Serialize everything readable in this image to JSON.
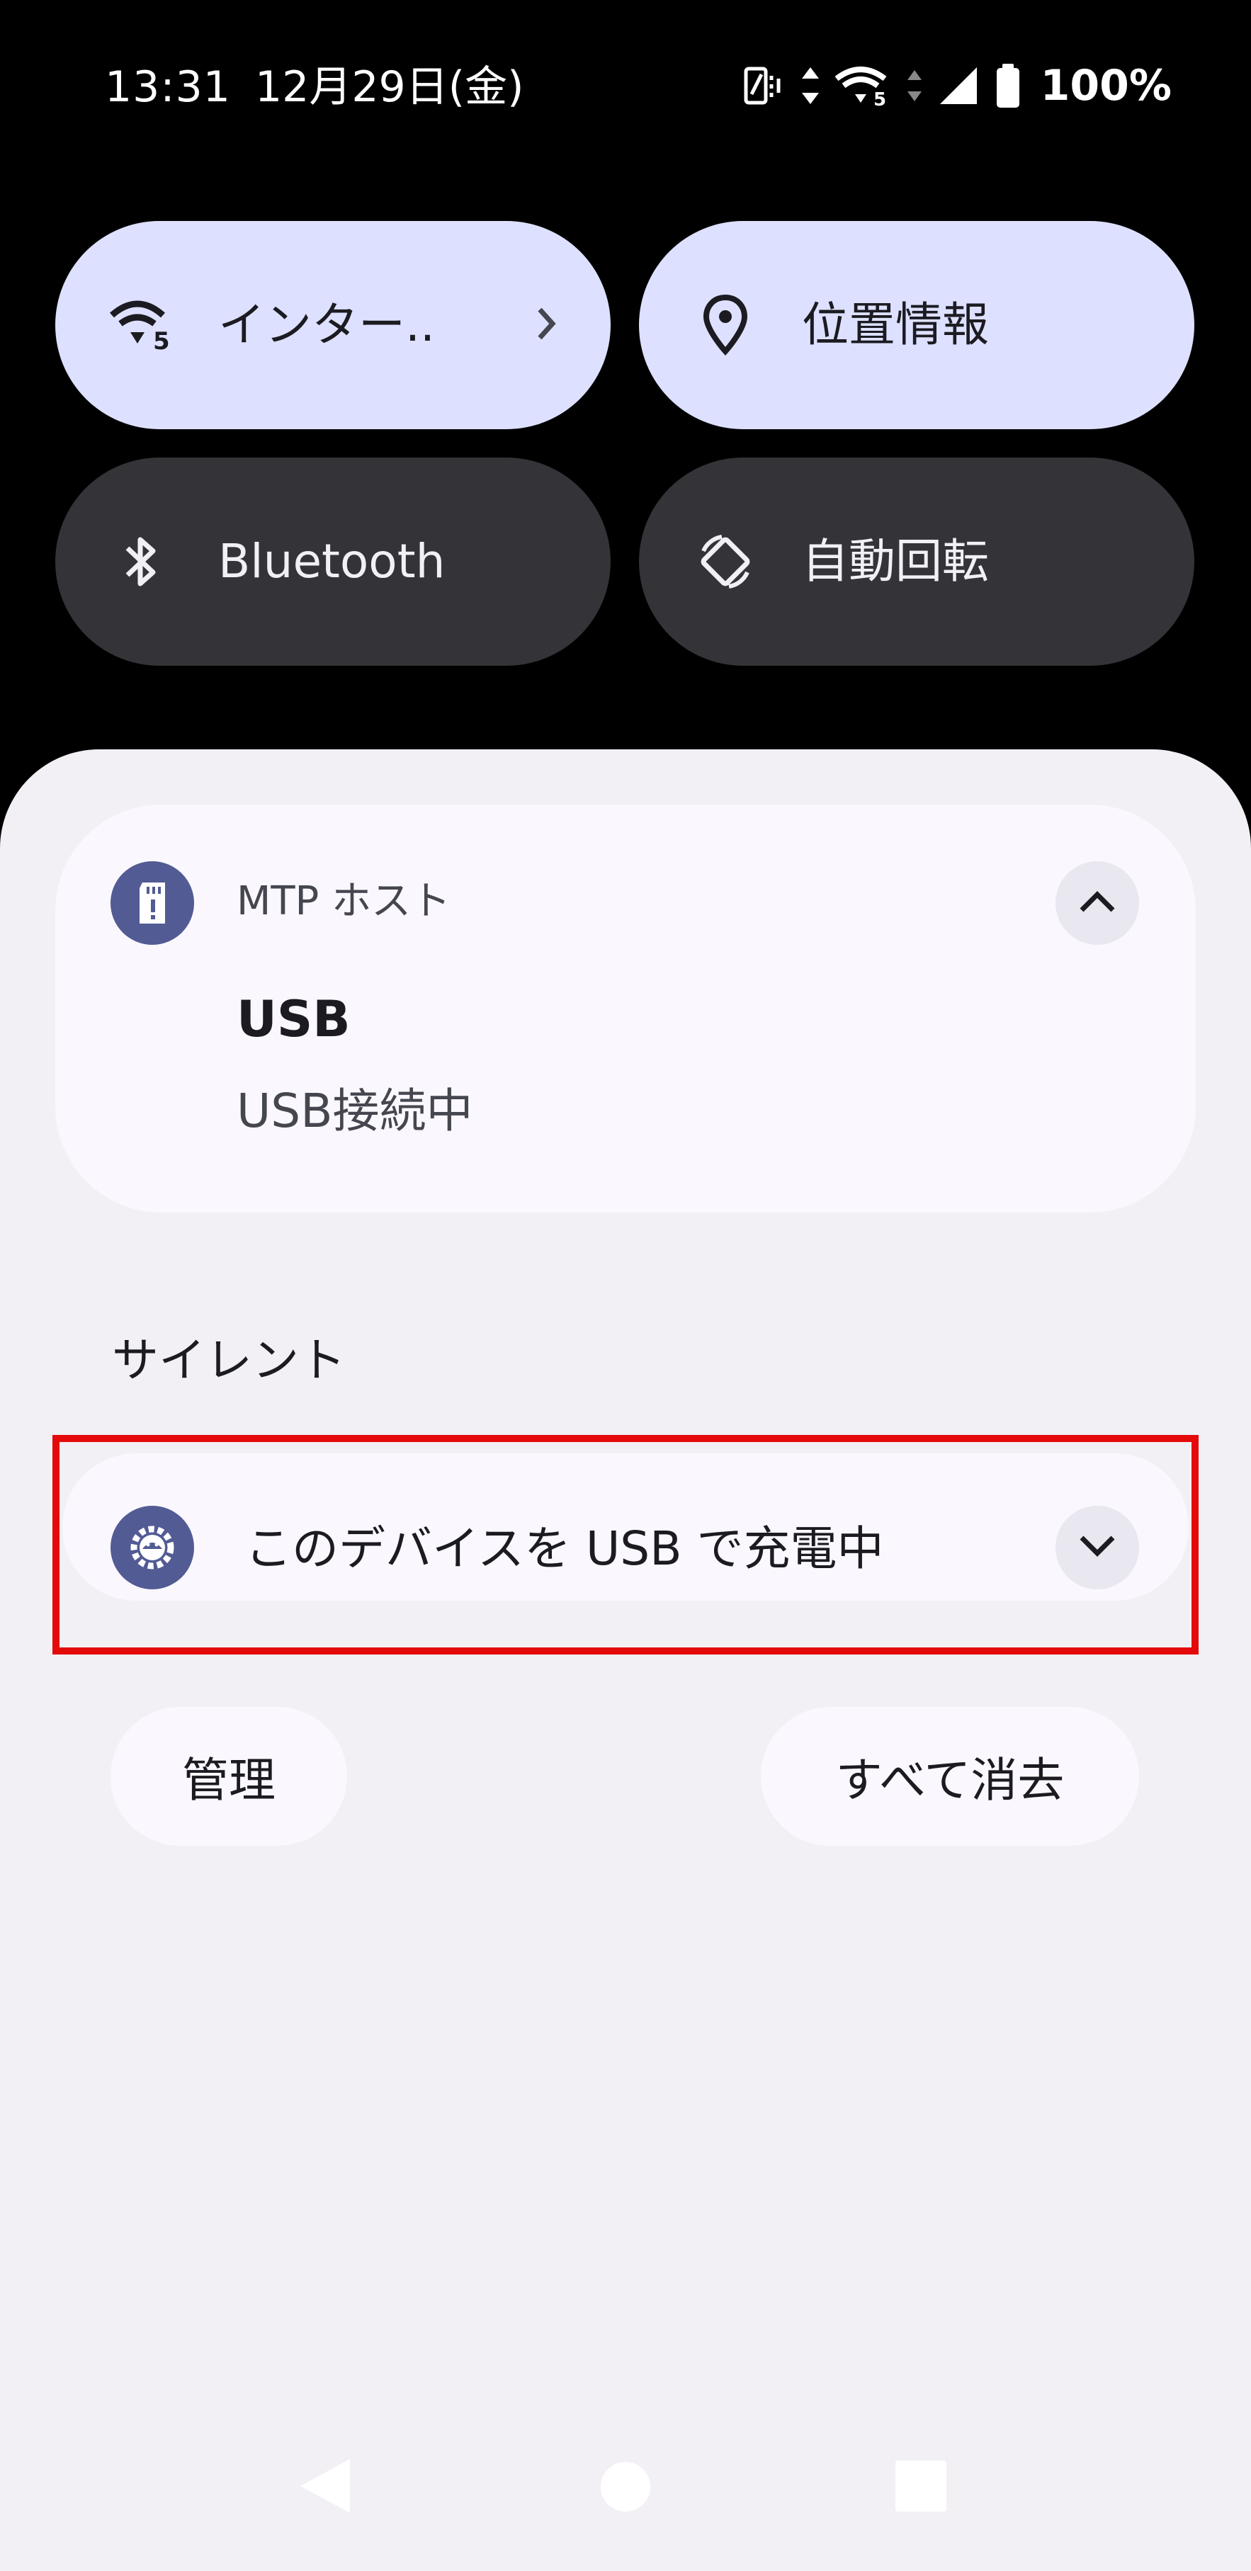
{
  "status_bar": {
    "time": "13:31",
    "date": "12月29日(金)",
    "battery_percent": "100%",
    "icons": [
      "vibrate-icon",
      "data-activity-icon",
      "wifi-6-icon",
      "signal-icon",
      "battery-icon"
    ]
  },
  "quick_tiles": [
    {
      "label": "インター..",
      "icon": "wifi-icon",
      "state": "on",
      "has_chevron": true
    },
    {
      "label": "位置情報",
      "icon": "location-pin-icon",
      "state": "on"
    },
    {
      "label": "Bluetooth",
      "icon": "bluetooth-icon",
      "state": "off"
    },
    {
      "label": "自動回転",
      "icon": "auto-rotate-icon",
      "state": "off"
    }
  ],
  "notification": {
    "app_name": "MTP ホスト",
    "title": "USB",
    "text": "USB接続中",
    "icon": "sd-card-icon",
    "expanded": true
  },
  "silent_section": {
    "header": "サイレント",
    "item_text": "このデバイスを USB で充電中",
    "icon": "android-settings-icon",
    "expanded": false
  },
  "actions": {
    "manage_label": "管理",
    "clear_all_label": "すべて消去"
  },
  "nav_bar": {
    "buttons": [
      "back-icon",
      "home-icon",
      "recents-icon"
    ]
  },
  "colors": {
    "tile_on": "#dde1ff",
    "tile_off": "#333338",
    "shade_bg": "#f2f0f5",
    "card_bg": "#faf8fe",
    "app_icon_bg": "#525b94",
    "highlight": "#e50a0a"
  }
}
